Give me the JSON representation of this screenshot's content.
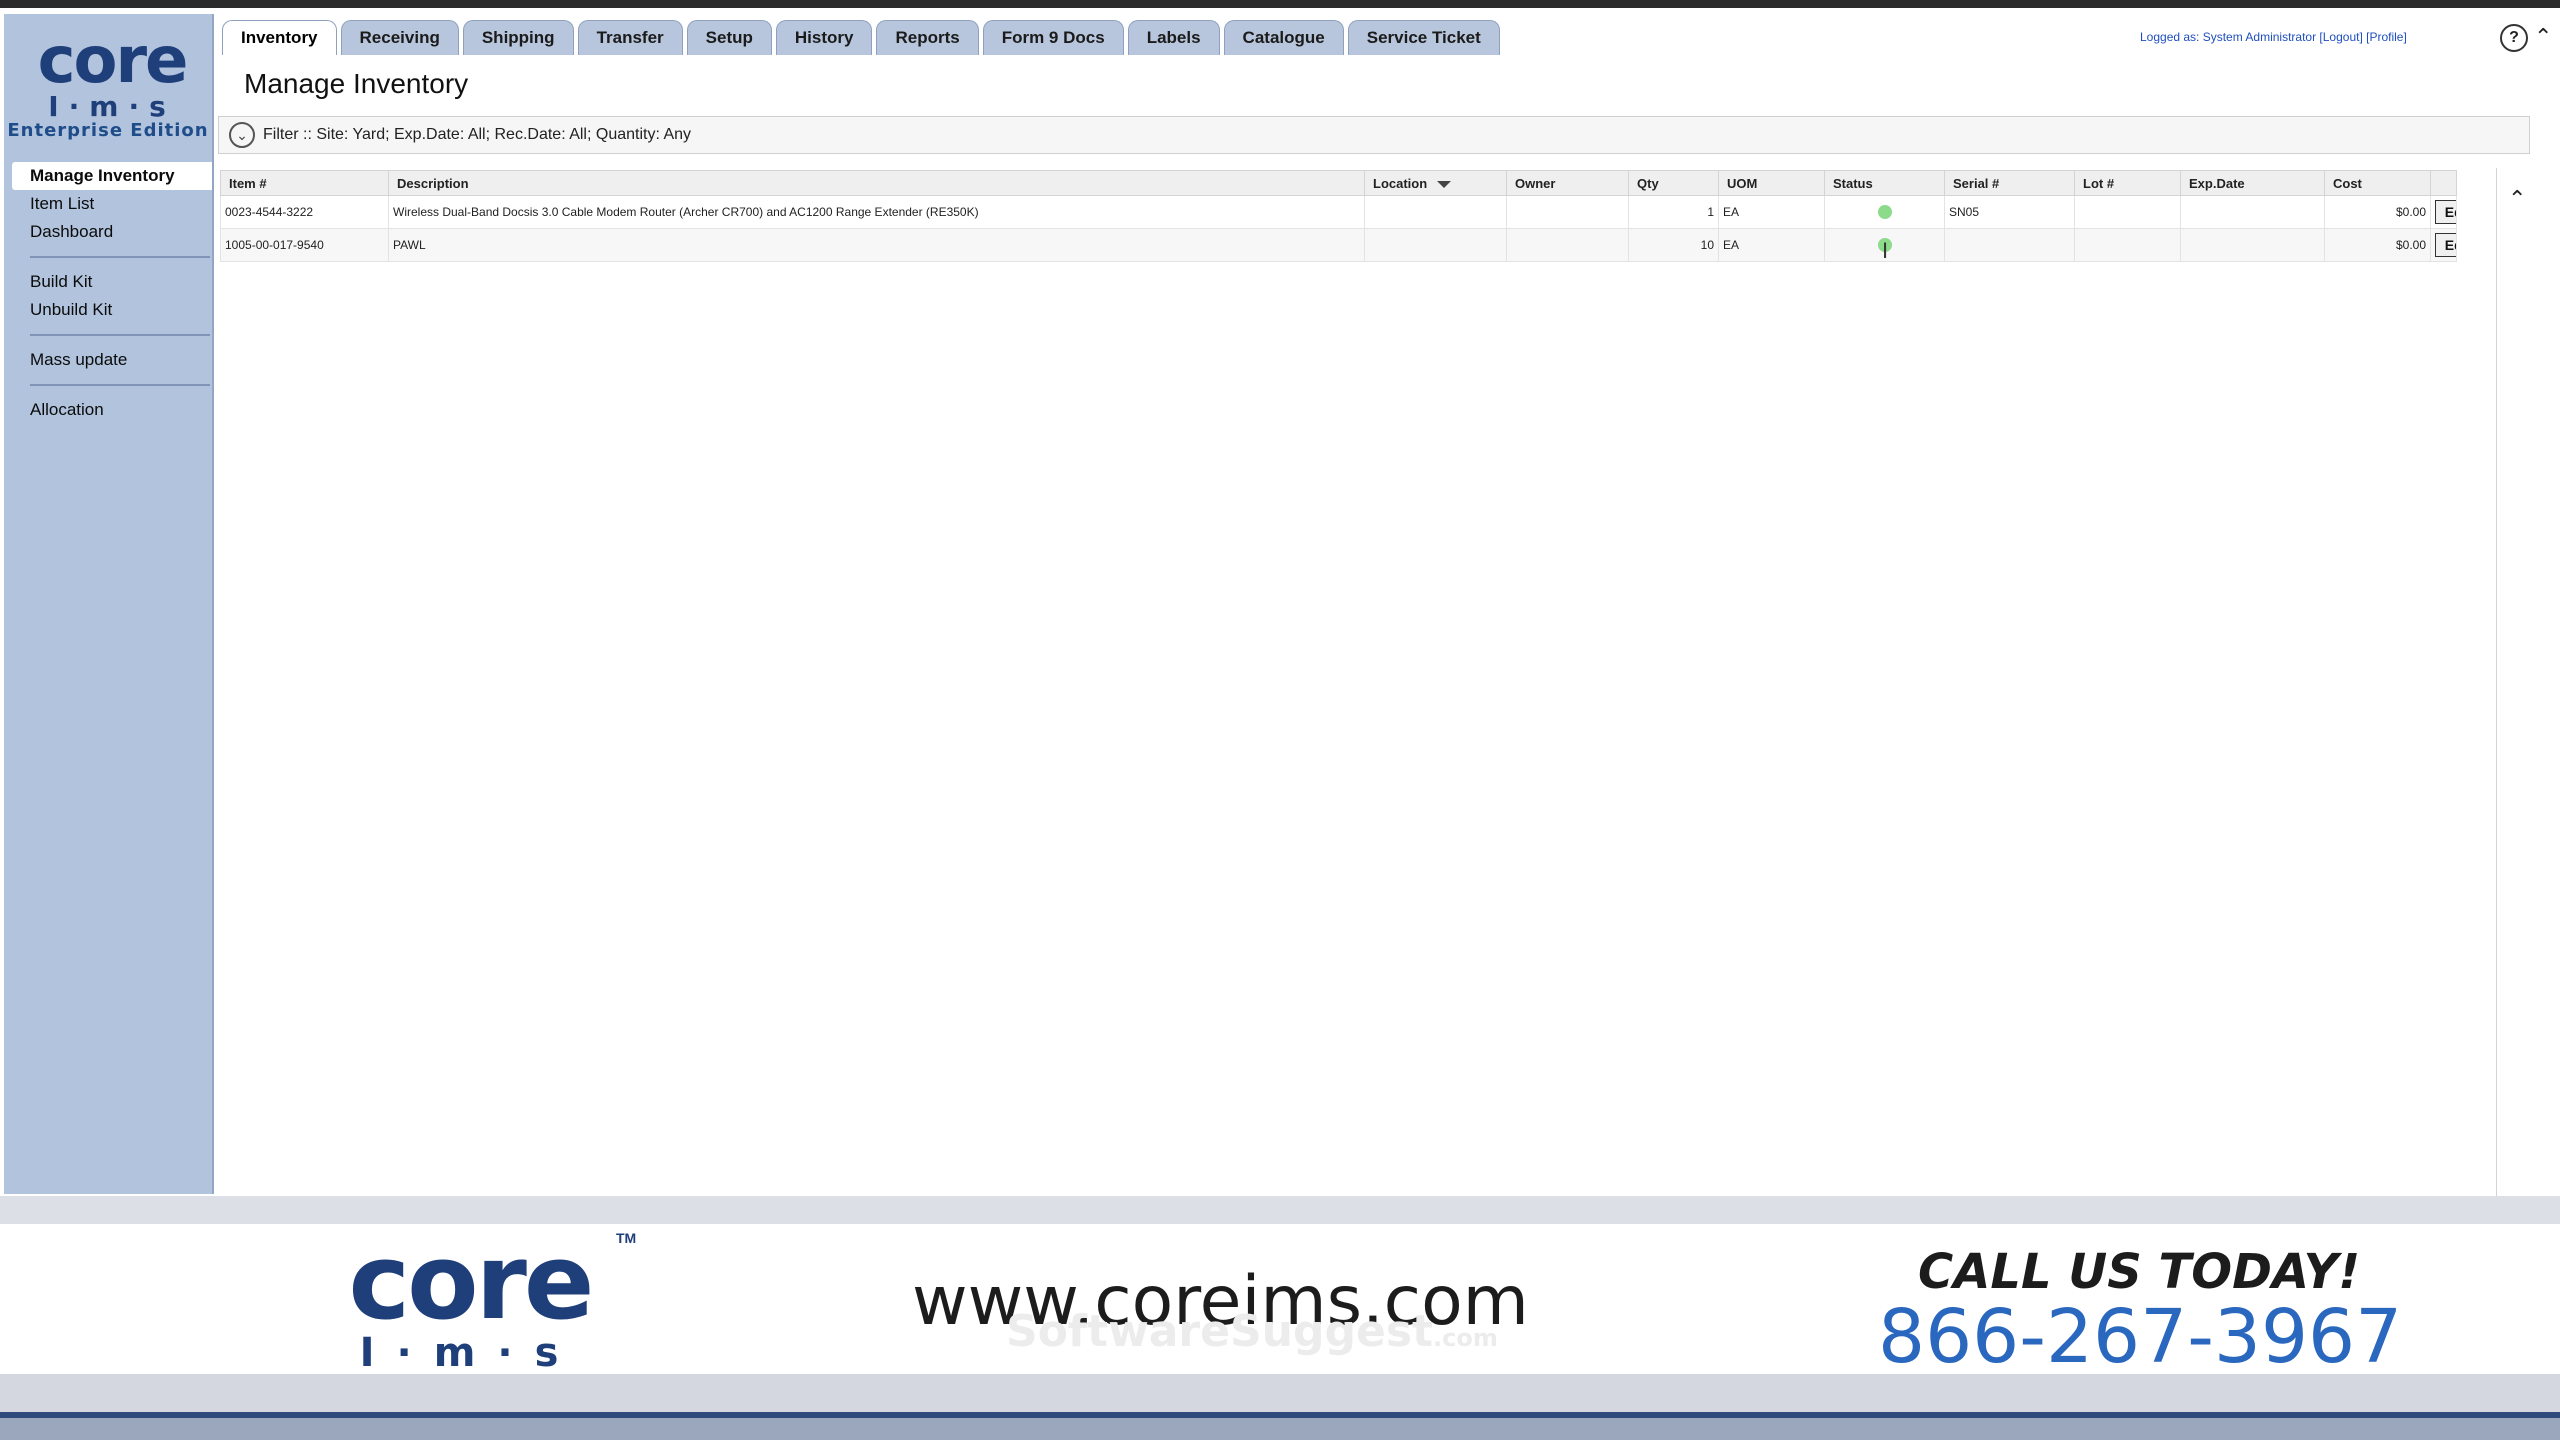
{
  "logo": {
    "word": "core",
    "sub": "I·m·s",
    "edition": "Enterprise Edition"
  },
  "sidebar": {
    "items": [
      {
        "label": "Manage Inventory"
      },
      {
        "label": "Item List"
      },
      {
        "label": "Dashboard"
      },
      {
        "label": "Build Kit"
      },
      {
        "label": "Unbuild Kit"
      },
      {
        "label": "Mass update"
      },
      {
        "label": "Allocation"
      }
    ]
  },
  "tabs": [
    {
      "label": "Inventory"
    },
    {
      "label": "Receiving"
    },
    {
      "label": "Shipping"
    },
    {
      "label": "Transfer"
    },
    {
      "label": "Setup"
    },
    {
      "label": "History"
    },
    {
      "label": "Reports"
    },
    {
      "label": "Form 9 Docs"
    },
    {
      "label": "Labels"
    },
    {
      "label": "Catalogue"
    },
    {
      "label": "Service Ticket"
    }
  ],
  "header": {
    "login_text": "Logged as: System Administrator [Logout] [Profile]",
    "help_glyph": "?"
  },
  "page": {
    "title": "Manage Inventory"
  },
  "filter": {
    "text": "Filter :: Site: Yard; Exp.Date: All; Rec.Date: All; Quantity: Any"
  },
  "table": {
    "columns": [
      "Item #",
      "Description",
      "Location",
      "Owner",
      "Qty",
      "UOM",
      "Status",
      "Serial #",
      "Lot #",
      "Exp.Date",
      "Cost"
    ],
    "rows": [
      {
        "item": "0023-4544-3222",
        "description": "Wireless Dual-Band Docsis 3.0 Cable Modem Router (Archer CR700) and AC1200 Range Extender (RE350K)",
        "location": "",
        "owner": "",
        "qty": "1",
        "uom": "EA",
        "status": "green",
        "serial": "SN05",
        "lot": "",
        "exp": "",
        "cost": "$0.00",
        "action": "Edit"
      },
      {
        "item": "1005-00-017-9540",
        "description": "PAWL",
        "location": "",
        "owner": "",
        "qty": "10",
        "uom": "EA",
        "status": "green",
        "serial": "",
        "lot": "",
        "exp": "",
        "cost": "$0.00",
        "action": "Edit"
      }
    ]
  },
  "footer": {
    "logo_word": "core",
    "logo_sub": "I·m·s",
    "tm": "TM",
    "url": "www.coreims.com",
    "watermark": "SoftwareSuggest",
    "watermark_suffix": ".com",
    "call": "CALL US TODAY!",
    "phone": "866-267-3967"
  },
  "colors": {
    "brand_navy": "#1f3f7a",
    "sidebar_bg": "#b1c3dd",
    "phone_blue": "#2a67bf",
    "status_green": "#8bdb8b"
  }
}
